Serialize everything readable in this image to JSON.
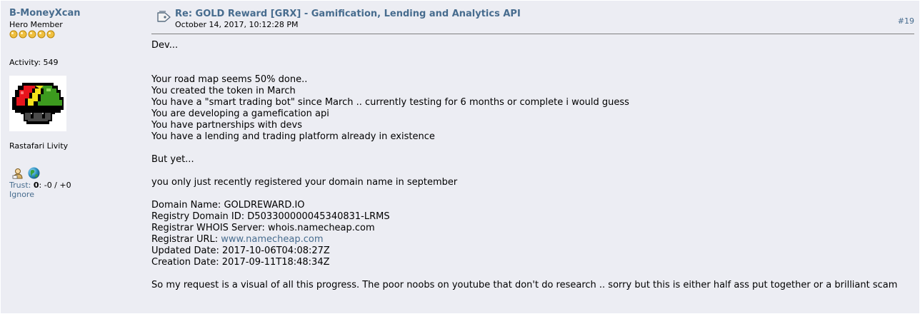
{
  "poster": {
    "name": "B-MoneyXcan",
    "rank": "Hero Member",
    "star_count": 5,
    "activity": "Activity: 549",
    "personal_text": "Rastafari Livity",
    "icons": [
      "profile-icon",
      "website-globe-icon"
    ],
    "trust_label": "Trust:",
    "trust_score": "0",
    "trust_detail": ": -0 / +0",
    "ignore_label": "Ignore"
  },
  "post": {
    "subject": "Re: GOLD Reward [GRX] - Gamification, Lending and Analytics API",
    "date": "October 14, 2017, 10:12:28 PM",
    "number": "#19",
    "body": {
      "greeting": "Dev...",
      "list": [
        "Your road map seems 50% done..",
        "You created the token in March",
        "You have a \"smart trading bot\" since March .. currently testing for 6 months or complete i would guess",
        "You are developing a gamefication api",
        "You have partnerships with devs",
        "You have a lending and trading platform already in existence"
      ],
      "but_yet": "But yet...",
      "registered": "you only just recently registered your domain name in september",
      "whois": {
        "domain_name": "Domain Name: GOLDREWARD.IO",
        "registry_id": "Registry Domain ID: D503300000045340831-LRMS",
        "whois_server": "Registrar WHOIS Server: whois.namecheap.com",
        "registrar_url_label": "Registrar URL: ",
        "registrar_url": "www.namecheap.com",
        "updated": "Updated Date: 2017-10-06T04:08:27Z",
        "created": "Creation Date: 2017-09-11T18:48:34Z"
      },
      "closing": "So my request is a visual of all this progress. The poor noobs on youtube that don't do research .. sorry but this is either half ass put together or a brilliant scam"
    }
  },
  "colors": {
    "background": "#ecedf3",
    "link": "#476c8e",
    "star": "#f0c040"
  }
}
